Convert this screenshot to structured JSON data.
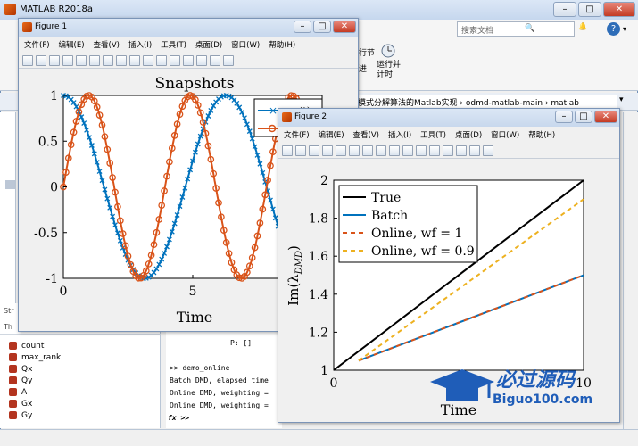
{
  "app": {
    "title": "MATLAB R2018a",
    "search_placeholder": "搜索文档",
    "help_icon": "?",
    "ribbon_run_label": "运行并\n计时",
    "ribbon_run_short": "行节",
    "ribbon_partial": "进"
  },
  "address": {
    "path": "模式分解算法的Matlab实现  ›  odmd-matlab-main  ›  matlab"
  },
  "workspace": {
    "tab_label": "Str",
    "header": "Th",
    "items": [
      "count",
      "max_rank",
      "Qx",
      "Qy",
      "A",
      "Gx",
      "Gy"
    ]
  },
  "command_window": {
    "lines": [
      "P: []",
      ">> demo_online",
      "Batch DMD, elapsed time",
      "Online DMD, weighting =",
      "Online DMD, weighting ="
    ],
    "prompt": "fx >>"
  },
  "figure1": {
    "title": "Figure 1",
    "menus": [
      "文件(F)",
      "编辑(E)",
      "查看(V)",
      "插入(I)",
      "工具(T)",
      "桌面(D)",
      "窗口(W)",
      "帮助(H)"
    ],
    "legend_partial": "(t)"
  },
  "figure2": {
    "title": "Figure 2",
    "menus": [
      "文件(F)",
      "编辑(E)",
      "查看(V)",
      "插入(I)",
      "工具(T)",
      "桌面(D)",
      "窗口(W)",
      "帮助(H)"
    ]
  },
  "watermark": {
    "title": "必过源码",
    "url": "Biguo100.com"
  },
  "colors": {
    "blue": "#0072BD",
    "orange": "#D95319",
    "gold": "#EDB120",
    "black": "#000000"
  },
  "chart_data": [
    {
      "type": "line",
      "title": "Snapshots",
      "xlabel": "Time",
      "ylabel": "",
      "xlim": [
        0,
        10
      ],
      "ylim": [
        -1,
        1
      ],
      "xticks": [
        0,
        5
      ],
      "yticks": [
        -1,
        -0.5,
        0,
        0.5,
        1
      ],
      "grid": false,
      "legend_position": "top-right",
      "series": [
        {
          "function": "cos",
          "omega": 1,
          "marker": "x",
          "color": "#0072BD"
        },
        {
          "function": "sin",
          "omega": 1.6,
          "marker": "o",
          "color": "#D95319"
        }
      ]
    },
    {
      "type": "line",
      "title": "",
      "xlabel": "Time",
      "ylabel": "Im(λ_DMD)",
      "xlim": [
        0,
        10
      ],
      "ylim": [
        1,
        2
      ],
      "xticks": [
        0,
        10
      ],
      "yticks": [
        1,
        1.2,
        1.4,
        1.6,
        1.8,
        2
      ],
      "grid": false,
      "legend_position": "top-left",
      "series": [
        {
          "name": "True",
          "color": "#000000",
          "style": "solid",
          "x": [
            0,
            10
          ],
          "y": [
            1,
            2
          ]
        },
        {
          "name": "Batch",
          "color": "#0072BD",
          "style": "solid",
          "x": [
            1,
            10
          ],
          "y": [
            1.05,
            1.5
          ]
        },
        {
          "name": "Online, wf = 1",
          "color": "#D95319",
          "style": "dashed",
          "x": [
            1,
            10
          ],
          "y": [
            1.05,
            1.5
          ]
        },
        {
          "name": "Online, wf = 0.9",
          "color": "#EDB120",
          "style": "dashed",
          "x": [
            1,
            10
          ],
          "y": [
            1.05,
            1.9
          ]
        }
      ]
    }
  ]
}
